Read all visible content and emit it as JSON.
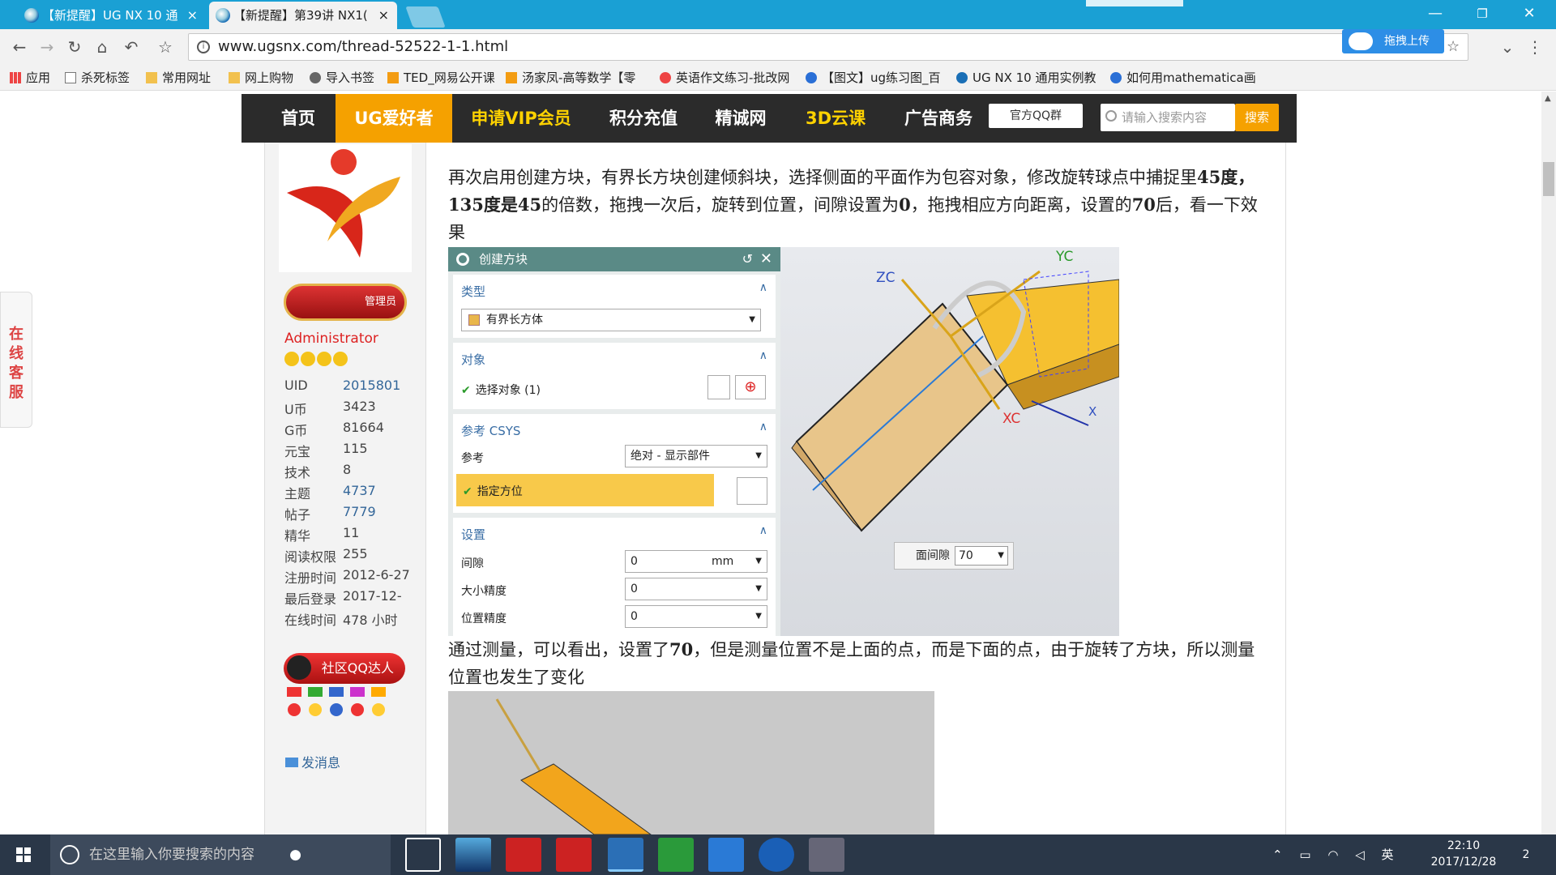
{
  "browser": {
    "tabs": [
      {
        "title": "【新提醒】UG NX 10 通",
        "close": "×"
      },
      {
        "title": "【新提醒】第39讲 NX1(",
        "close": "×"
      }
    ],
    "window_controls": {
      "minimize": "—",
      "restore": "❐",
      "close": "✕"
    },
    "url": "www.ugsnx.com/thread-52522-1-1.html",
    "upload_button": "拖拽上传",
    "bookmarks": [
      "应用",
      "杀死标签",
      "常用网址",
      "网上购物",
      "导入书签",
      "TED_网易公开课",
      "汤家凤-高等数学【零",
      "英语作文练习-批改网",
      "【图文】ug练习图_百",
      "UG NX 10 通用实例教",
      "如何用mathematica画"
    ]
  },
  "site_nav": {
    "items": [
      "首页",
      "UG爱好者",
      "申请VIP会员",
      "积分充值",
      "精诚网",
      "3D云课",
      "广告商务"
    ],
    "qq_group": "官方QQ群",
    "search_placeholder": "请输入搜索内容",
    "search_button": "搜索"
  },
  "user_panel": {
    "admin_badge": "管理员",
    "username": "Administrator",
    "stats": [
      {
        "label": "UID",
        "value": "2015801"
      },
      {
        "label": "U币",
        "value": "3423"
      },
      {
        "label": "G币",
        "value": "81664"
      },
      {
        "label": "元宝",
        "value": "115"
      },
      {
        "label": "技术",
        "value": "8"
      },
      {
        "label": "主题",
        "value": "4737"
      },
      {
        "label": "帖子",
        "value": "7779"
      },
      {
        "label": "精华",
        "value": "11"
      },
      {
        "label": "阅读权限",
        "value": "255"
      },
      {
        "label": "注册时间",
        "value": "2012-6-27"
      },
      {
        "label": "最后登录",
        "value": "2017-12-"
      },
      {
        "label": "在线时间",
        "value": "478 小时"
      }
    ],
    "qq_badge": "社区QQ达人",
    "send_message": "发消息"
  },
  "side_service": "在线客服",
  "content": {
    "para1_a": "再次启用创建方块，有界长方块创建倾斜块，选择侧面的平面作为包容对象，修改旋转球点中捕捉里",
    "para1_b": "45度，",
    "para1_c": "135度是45",
    "para1_d": "的倍数，拖拽一次后，旋转到位置，间隙设置为",
    "para1_e": "0",
    "para1_f": "，拖拽相应方向距离，设置的",
    "para1_g": "70",
    "para1_h": "后，看一下效果",
    "para2_a": "通过测量，可以看出，设置了",
    "para2_b": "70",
    "para2_c": "，但是测量位置不是上面的点，而是下面的点，由于旋转了方块，所以测量位置也发生了变化"
  },
  "nx_dialog": {
    "title": "创建方块",
    "type_section": "类型",
    "type_value": "有界长方体",
    "object_section": "对象",
    "select_object": "选择对象 (1)",
    "csys_section": "参考 CSYS",
    "reference_label": "参考",
    "reference_value": "绝对 - 显示部件",
    "specify_orient": "指定方位",
    "settings_section": "设置",
    "gap_label": "间隙",
    "gap_value": "0",
    "gap_unit": "mm",
    "size_precision_label": "大小精度",
    "size_precision_value": "0",
    "pos_precision_label": "位置精度",
    "pos_precision_value": "0"
  },
  "viewport": {
    "axis_zc": "ZC",
    "axis_yc": "YC",
    "axis_xc": "XC",
    "axis_x": "X",
    "gap_label": "面间隙",
    "gap_value": "70"
  },
  "taskbar": {
    "search_placeholder": "在这里输入你要搜索的内容",
    "ime": "英",
    "time": "22:10",
    "date": "2017/12/28",
    "notifications": "2"
  },
  "colors": {
    "tabbar": "#1aa0d4",
    "nav_bg": "#2b2b2b",
    "accent": "#f5a100",
    "dialog_header": "#5a8a86"
  }
}
